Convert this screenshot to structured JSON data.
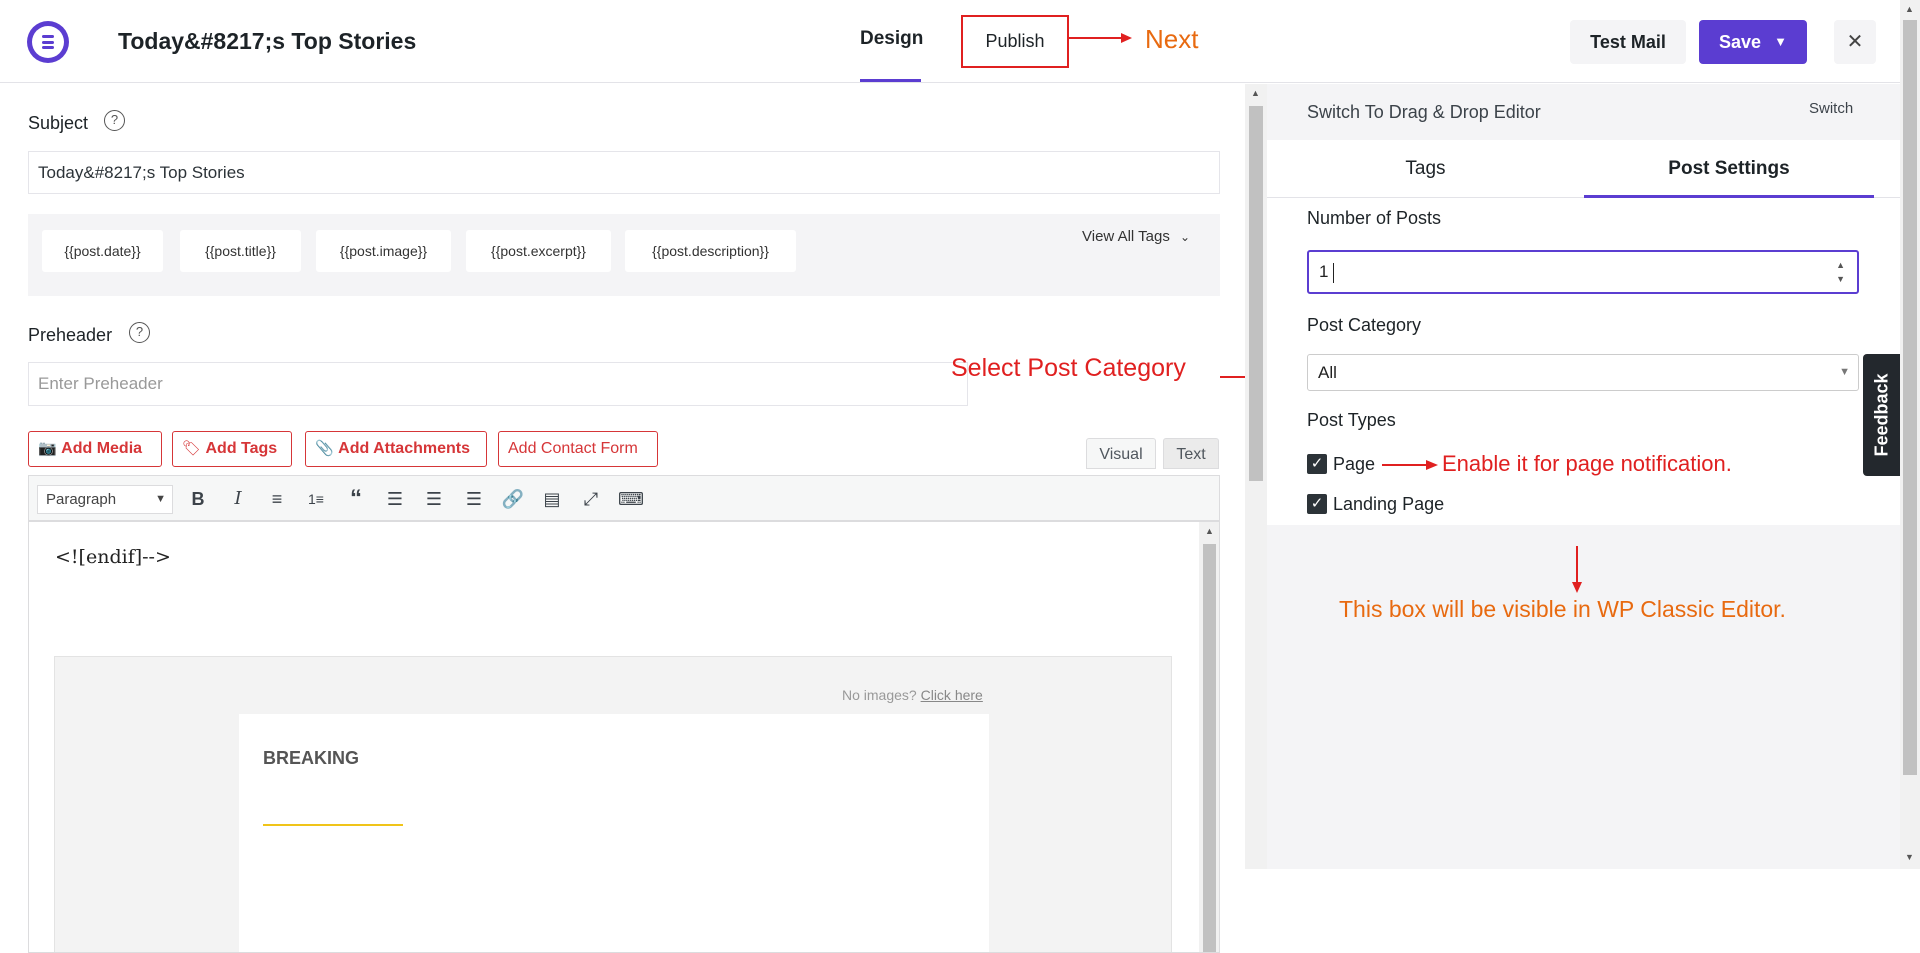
{
  "header": {
    "title": "Today&#8217;s Top Stories",
    "nav_design": "Design",
    "nav_publish": "Publish",
    "test_mail": "Test Mail",
    "save": "Save"
  },
  "annotations": {
    "next": "Next",
    "select_category": "Select Post Category",
    "enable_page": "Enable it for page notification.",
    "classic_editor": "This box will be visible in WP Classic Editor."
  },
  "subject": {
    "label": "Subject",
    "value": "Today&#8217;s Top Stories"
  },
  "tags": {
    "chips": [
      "{{post.date}}",
      "{{post.title}}",
      "{{post.image}}",
      "{{post.excerpt}}",
      "{{post.description}}"
    ],
    "view_all": "View All Tags"
  },
  "preheader": {
    "label": "Preheader",
    "placeholder": "Enter Preheader"
  },
  "media_buttons": {
    "add_media": "Add Media",
    "add_tags": "Add Tags",
    "add_attachments": "Add Attachments",
    "add_contact_form": "Add Contact Form"
  },
  "editor": {
    "visual_tab": "Visual",
    "text_tab": "Text",
    "format": "Paragraph",
    "content_line": "<![endif]-->",
    "no_images": "No images?",
    "click_here": "Click here",
    "breaking": "BREAKING",
    "accent_color": "#f0c419"
  },
  "sidebar": {
    "switch_title": "Switch To Drag & Drop Editor",
    "switch_link": "Switch",
    "tabs": [
      "Tags",
      "Post Settings"
    ],
    "active_tab": "Post Settings",
    "number_of_posts_label": "Number of Posts",
    "number_of_posts_value": "1",
    "post_category_label": "Post Category",
    "post_category_value": "All",
    "post_types_label": "Post Types",
    "post_types": [
      {
        "label": "Page",
        "checked": true
      },
      {
        "label": "Landing Page",
        "checked": true
      }
    ],
    "feedback": "Feedback"
  },
  "colors": {
    "brand": "#5b3dd1",
    "annotation_red": "#e02020",
    "annotation_orange": "#e86a10"
  }
}
